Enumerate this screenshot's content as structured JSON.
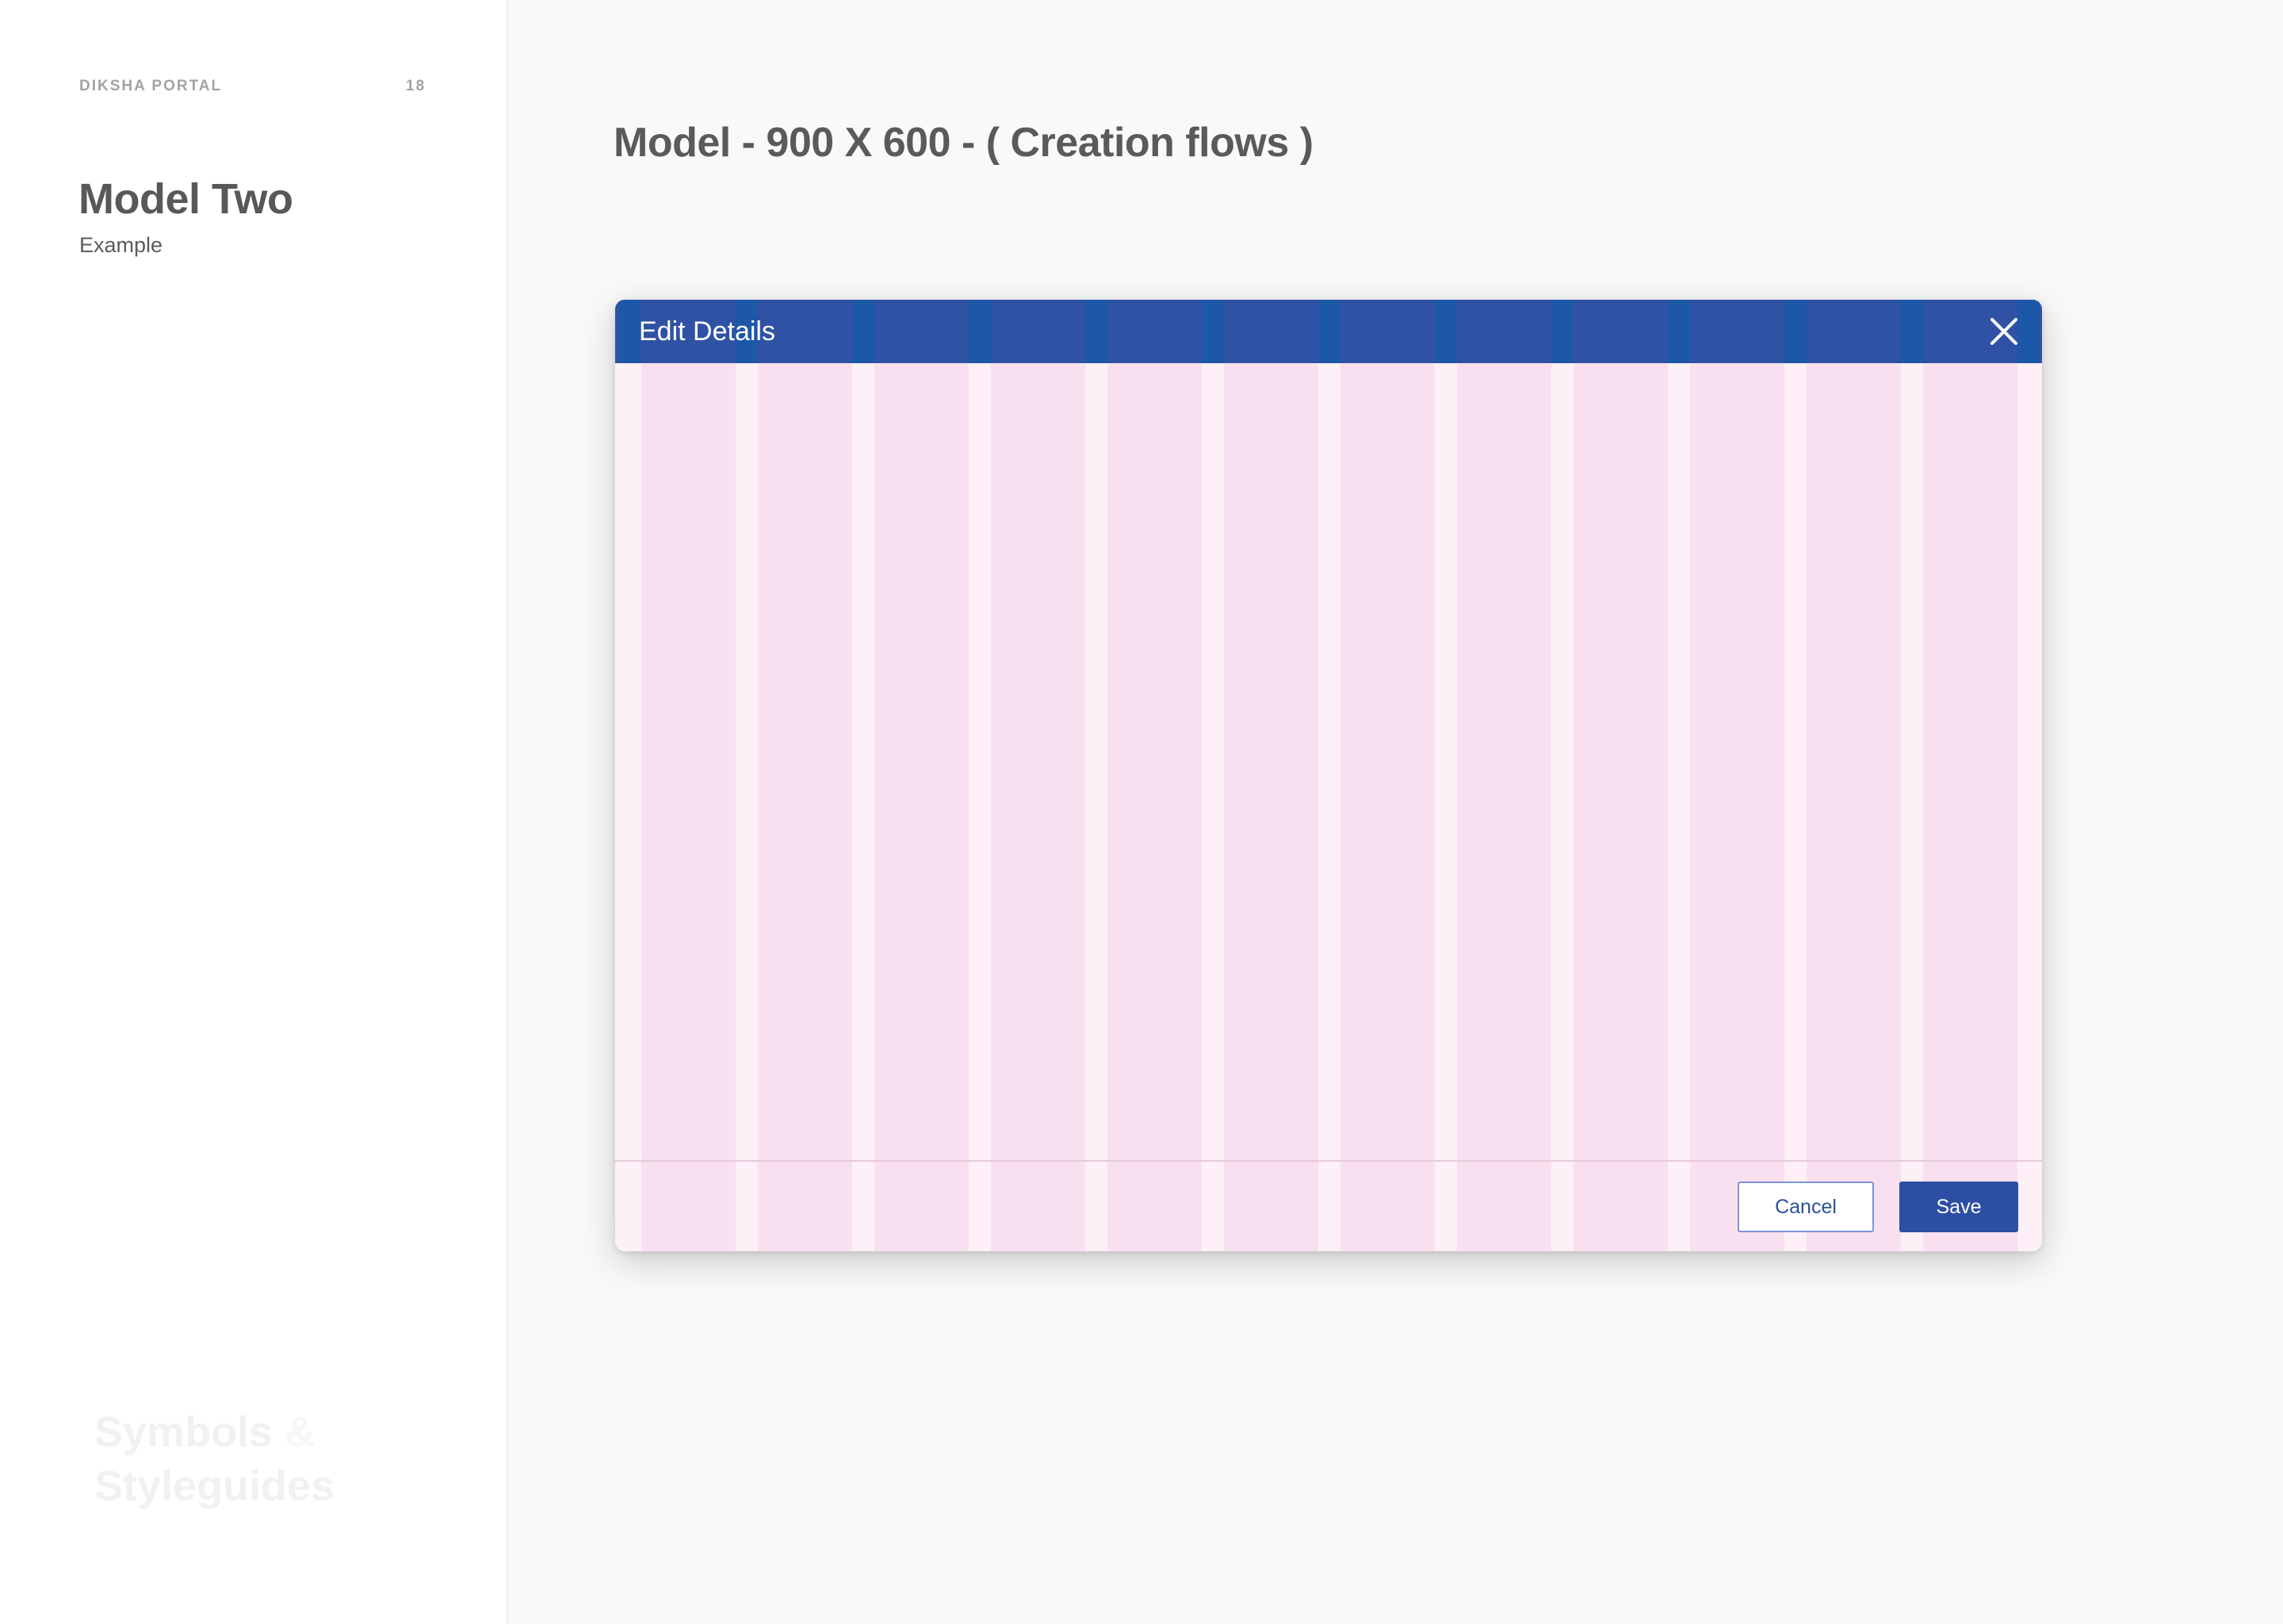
{
  "sidebar": {
    "portal_label": "DIKSHA PORTAL",
    "page_number": "18",
    "title": "Model Two",
    "subtitle": "Example",
    "watermark_line1": "Symbols",
    "watermark_amp": "&",
    "watermark_line2": "Styleguides"
  },
  "main": {
    "heading": "Model - 900 X 600 - ( Creation flows )"
  },
  "modal": {
    "title": "Edit Details",
    "close_icon": "close-icon",
    "grid_columns": 12,
    "buttons": {
      "cancel_label": "Cancel",
      "save_label": "Save"
    }
  },
  "colors": {
    "header": "#3052a5",
    "grid_column": "#f9e0f0",
    "grid_gutter": "#fdf0f7",
    "primary_button": "#2c4fa4"
  }
}
